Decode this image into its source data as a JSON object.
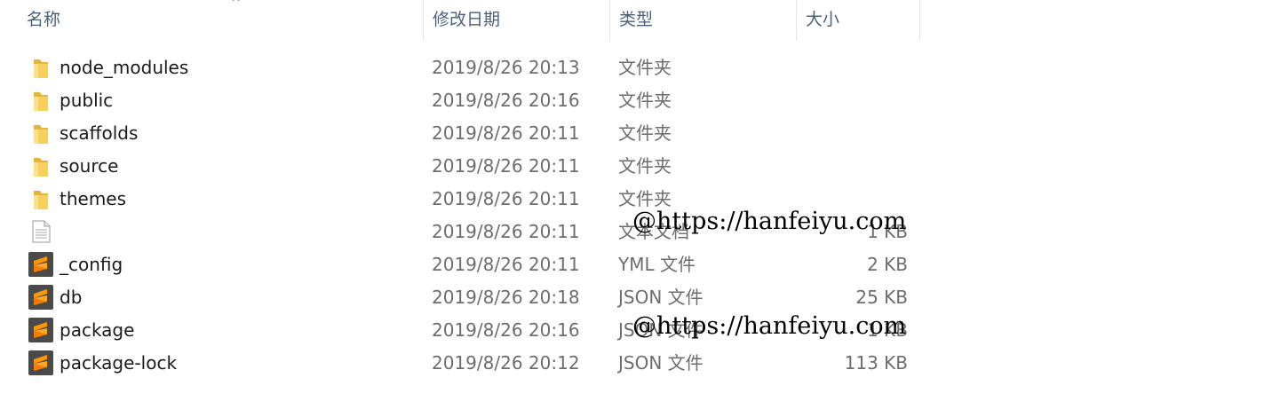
{
  "columns": {
    "name": "名称",
    "date": "修改日期",
    "type": "类型",
    "size": "大小"
  },
  "sort_indicator": "^",
  "files": [
    {
      "name": "node_modules",
      "date": "2019/8/26 20:13",
      "type": "文件夹",
      "size": "",
      "icon": "folder-icon"
    },
    {
      "name": "public",
      "date": "2019/8/26 20:16",
      "type": "文件夹",
      "size": "",
      "icon": "folder-icon"
    },
    {
      "name": "scaffolds",
      "date": "2019/8/26 20:11",
      "type": "文件夹",
      "size": "",
      "icon": "folder-icon"
    },
    {
      "name": "source",
      "date": "2019/8/26 20:11",
      "type": "文件夹",
      "size": "",
      "icon": "folder-icon"
    },
    {
      "name": "themes",
      "date": "2019/8/26 20:11",
      "type": "文件夹",
      "size": "",
      "icon": "folder-icon"
    },
    {
      "name": "",
      "date": "2019/8/26 20:11",
      "type": "文本文档",
      "size": "1 KB",
      "icon": "text-file-icon"
    },
    {
      "name": "_config",
      "date": "2019/8/26 20:11",
      "type": "YML 文件",
      "size": "2 KB",
      "icon": "sublime-file-icon"
    },
    {
      "name": "db",
      "date": "2019/8/26 20:18",
      "type": "JSON 文件",
      "size": "25 KB",
      "icon": "sublime-file-icon"
    },
    {
      "name": "package",
      "date": "2019/8/26 20:16",
      "type": "JSON 文件",
      "size": "1 KB",
      "icon": "sublime-file-icon"
    },
    {
      "name": "package-lock",
      "date": "2019/8/26 20:12",
      "type": "JSON 文件",
      "size": "113 KB",
      "icon": "sublime-file-icon"
    }
  ],
  "watermarks": [
    "@https://hanfeiyu.com",
    "@https://hanfeiyu.com"
  ],
  "colors": {
    "header_text": "#4c607a",
    "folder": "#f4c64b",
    "sublime_bg": "#4a4a4a",
    "sublime_accent": "#ff9800"
  }
}
